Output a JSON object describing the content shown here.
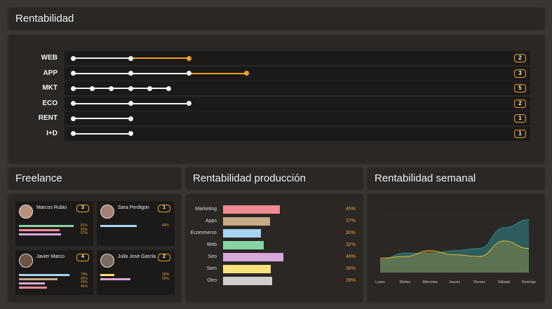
{
  "headers": {
    "rentabilidad": "Rentabilidad",
    "freelance": "Freelance",
    "produccion": "Rentabilidad producción",
    "semanal": "Rentabilidad semanal"
  },
  "rentabilidad_rows": [
    {
      "label": "WEB",
      "count": "2"
    },
    {
      "label": "APP",
      "count": "3"
    },
    {
      "label": "MKT",
      "count": "5"
    },
    {
      "label": "ECO",
      "count": "2"
    },
    {
      "label": "RENT",
      "count": "1"
    },
    {
      "label": "I+D",
      "count": "1"
    }
  ],
  "freelance": [
    {
      "name": "Marcos Rubio",
      "count": "3",
      "pcts": [
        "81%",
        "65%",
        "67%"
      ]
    },
    {
      "name": "Sara Perdigon",
      "count": "1",
      "pcts": [
        "64%"
      ]
    },
    {
      "name": "Javier Marco",
      "count": "4",
      "pcts": [
        "79%",
        "65%",
        "42%",
        "46%"
      ]
    },
    {
      "name": "Julio José García",
      "count": "2",
      "pcts": [
        "30%",
        "50%"
      ]
    }
  ],
  "chart_data": [
    {
      "type": "bar",
      "categories": [
        "Marketing",
        "Apps",
        "Ecommerce",
        "Web",
        "Seo",
        "Sem",
        "Otro"
      ],
      "values": [
        45,
        37,
        30,
        32,
        48,
        38,
        39
      ],
      "labels": [
        "45%",
        "37%",
        "30%",
        "32%",
        "48%",
        "38%",
        "39%"
      ],
      "colors": [
        "#f28b94",
        "#c7a886",
        "#a6d5f2",
        "#88d4a4",
        "#d8a8dc",
        "#f8e07a",
        "#cfcfcf"
      ]
    },
    {
      "type": "area",
      "categories": [
        "Lunes",
        "Martes",
        "Miercoles",
        "Jueves",
        "Viernes",
        "Sábado",
        "Domingo"
      ],
      "series": [
        {
          "values": [
            22,
            34,
            33,
            38,
            42,
            78,
            92
          ],
          "color": "#2f8b8b"
        },
        {
          "values": [
            25,
            28,
            38,
            31,
            28,
            55,
            42
          ],
          "color": "#e8b830"
        }
      ],
      "ylim": [
        0,
        100
      ]
    }
  ]
}
